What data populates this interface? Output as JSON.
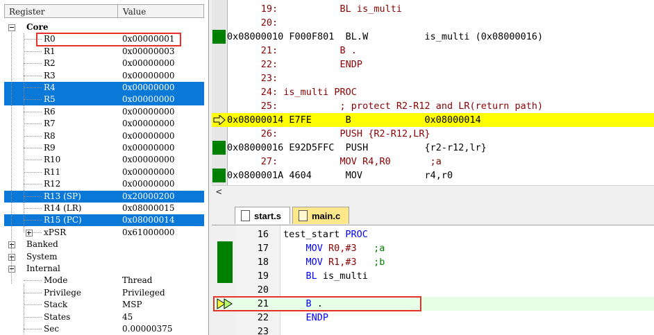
{
  "registers": {
    "header": {
      "register": "Register",
      "value": "Value"
    },
    "core_label": "Core",
    "core_rows": [
      {
        "name": "R0",
        "value": "0x00000001",
        "selected": false
      },
      {
        "name": "R1",
        "value": "0x00000003",
        "selected": false
      },
      {
        "name": "R2",
        "value": "0x00000000",
        "selected": false
      },
      {
        "name": "R3",
        "value": "0x00000000",
        "selected": false
      },
      {
        "name": "R4",
        "value": "0x00000000",
        "selected": true
      },
      {
        "name": "R5",
        "value": "0x00000000",
        "selected": true
      },
      {
        "name": "R6",
        "value": "0x00000000",
        "selected": false
      },
      {
        "name": "R7",
        "value": "0x00000000",
        "selected": false
      },
      {
        "name": "R8",
        "value": "0x00000000",
        "selected": false
      },
      {
        "name": "R9",
        "value": "0x00000000",
        "selected": false
      },
      {
        "name": "R10",
        "value": "0x00000000",
        "selected": false
      },
      {
        "name": "R11",
        "value": "0x00000000",
        "selected": false
      },
      {
        "name": "R12",
        "value": "0x00000000",
        "selected": false
      },
      {
        "name": "R13 (SP)",
        "value": "0x20000200",
        "selected": true
      },
      {
        "name": "R14 (LR)",
        "value": "0x08000015",
        "selected": false
      },
      {
        "name": "R15 (PC)",
        "value": "0x08000014",
        "selected": true
      }
    ],
    "xpsr": {
      "name": "xPSR",
      "value": "0x61000000"
    },
    "groups": {
      "banked": "Banked",
      "system": "System",
      "internal": "Internal"
    },
    "internal_rows": [
      {
        "name": "Mode",
        "value": "Thread"
      },
      {
        "name": "Privilege",
        "value": "Privileged"
      },
      {
        "name": "Stack",
        "value": "MSP"
      },
      {
        "name": "States",
        "value": "45"
      },
      {
        "name": "Sec",
        "value": "0.00000375"
      }
    ]
  },
  "disassembly": {
    "lines": [
      {
        "kind": "src",
        "text": "      19:           BL is_multi",
        "mark": false,
        "current": false
      },
      {
        "kind": "src",
        "text": "      20:",
        "mark": false,
        "current": false
      },
      {
        "kind": "asm",
        "text": "0x08000010 F000F801  BL.W          is_multi (0x08000016)",
        "mark": true,
        "current": false
      },
      {
        "kind": "src",
        "text": "      21:           B .",
        "mark": false,
        "current": false
      },
      {
        "kind": "src",
        "text": "      22:           ENDP",
        "mark": false,
        "current": false
      },
      {
        "kind": "src",
        "text": "      23:",
        "mark": false,
        "current": false
      },
      {
        "kind": "src",
        "text": "      24: is_multi PROC",
        "mark": false,
        "current": false
      },
      {
        "kind": "src",
        "text": "      25:           ; protect R2-R12 and LR(return path)",
        "mark": false,
        "current": false
      },
      {
        "kind": "asm",
        "text": "0x08000014 E7FE      B             0x08000014",
        "mark": false,
        "current": true
      },
      {
        "kind": "src",
        "text": "      26:           PUSH {R2-R12,LR}",
        "mark": false,
        "current": false
      },
      {
        "kind": "asm",
        "text": "0x08000016 E92D5FFC  PUSH          {r2-r12,lr}",
        "mark": true,
        "current": false
      },
      {
        "kind": "src",
        "text": "      27:           MOV R4,R0       ;a",
        "mark": false,
        "current": false
      },
      {
        "kind": "asm",
        "text": "0x0800001A 4604      MOV           r4,r0",
        "mark": true,
        "current": false
      }
    ],
    "scroll_left": "<"
  },
  "editor": {
    "tabs": [
      {
        "label": "start.s",
        "active": true
      },
      {
        "label": "main.c",
        "active": false
      }
    ],
    "lines": [
      {
        "num": "16",
        "mark": false,
        "current": false,
        "parts": [
          {
            "t": "test_start ",
            "c": "plain"
          },
          {
            "t": "PROC",
            "c": "kw"
          }
        ]
      },
      {
        "num": "17",
        "mark": true,
        "current": false,
        "parts": [
          {
            "t": "    ",
            "c": "plain"
          },
          {
            "t": "MOV",
            "c": "kw"
          },
          {
            "t": " R0",
            "c": "op"
          },
          {
            "t": ",#3",
            "c": "num"
          },
          {
            "t": "   ;a",
            "c": "cm"
          }
        ]
      },
      {
        "num": "18",
        "mark": true,
        "current": false,
        "parts": [
          {
            "t": "    ",
            "c": "plain"
          },
          {
            "t": "MOV",
            "c": "kw"
          },
          {
            "t": " R1",
            "c": "op"
          },
          {
            "t": ",#3",
            "c": "num"
          },
          {
            "t": "   ;b",
            "c": "cm"
          }
        ]
      },
      {
        "num": "19",
        "mark": true,
        "current": false,
        "parts": [
          {
            "t": "    ",
            "c": "plain"
          },
          {
            "t": "BL",
            "c": "kw"
          },
          {
            "t": " is_multi",
            "c": "plain"
          }
        ]
      },
      {
        "num": "20",
        "mark": false,
        "current": false,
        "parts": []
      },
      {
        "num": "21",
        "mark": false,
        "current": true,
        "parts": [
          {
            "t": "    ",
            "c": "plain"
          },
          {
            "t": "B",
            "c": "kw"
          },
          {
            "t": " .",
            "c": "plain"
          }
        ]
      },
      {
        "num": "22",
        "mark": false,
        "current": false,
        "parts": [
          {
            "t": "    ",
            "c": "plain"
          },
          {
            "t": "ENDP",
            "c": "kw"
          }
        ]
      },
      {
        "num": "23",
        "mark": false,
        "current": false,
        "parts": []
      }
    ]
  },
  "colors": {
    "selection": "#0a78d7",
    "exec_mark": "#008000",
    "current_line": "#ffff00",
    "highlight_box": "#e8302a"
  },
  "icons": {
    "current_instruction": "yellow-arrow-icon",
    "editor_pc": "double-arrow-icon",
    "file_tab": "file-icon"
  }
}
